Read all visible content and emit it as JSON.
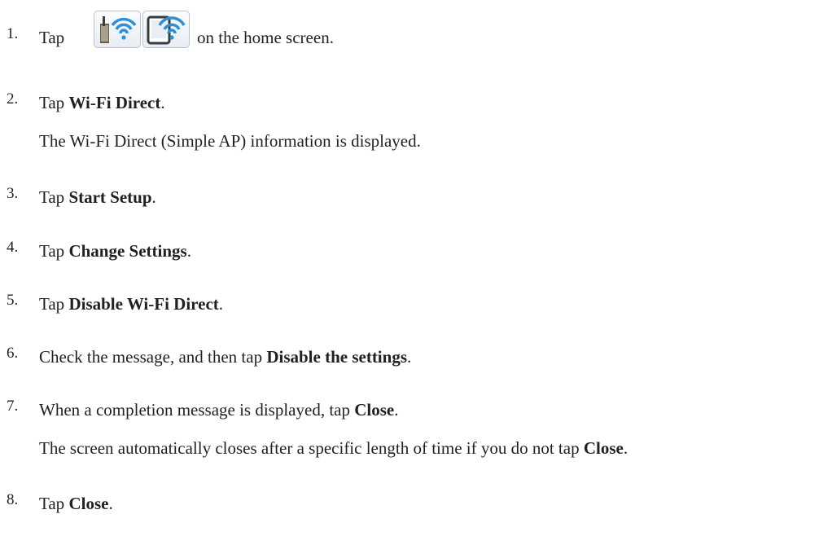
{
  "steps": [
    {
      "num": "1.",
      "prefix": "Tap",
      "suffix": "on the home screen.",
      "icons": [
        "wifi-router-icon",
        "wifi-direct-device-icon"
      ]
    },
    {
      "num": "2.",
      "prefix": "Tap ",
      "bold": "Wi-Fi Direct",
      "suffix": ".",
      "note": "The Wi-Fi Direct (Simple AP) information is displayed."
    },
    {
      "num": "3.",
      "prefix": "Tap ",
      "bold": "Start Setup",
      "suffix": "."
    },
    {
      "num": "4.",
      "prefix": "Tap ",
      "bold": "Change Settings",
      "suffix": "."
    },
    {
      "num": "5.",
      "prefix": "Tap ",
      "bold": "Disable Wi-Fi Direct",
      "suffix": "."
    },
    {
      "num": "6.",
      "prefix": "Check the message, and then tap ",
      "bold": "Disable the settings",
      "suffix": "."
    },
    {
      "num": "7.",
      "prefix": "When a completion message is displayed, tap ",
      "bold": "Close",
      "suffix": ".",
      "note_prefix": "The screen automatically closes after a specific length of time if you do not tap ",
      "note_bold": "Close",
      "note_suffix": "."
    },
    {
      "num": "8.",
      "prefix": "Tap ",
      "bold": "Close",
      "suffix": "."
    }
  ]
}
